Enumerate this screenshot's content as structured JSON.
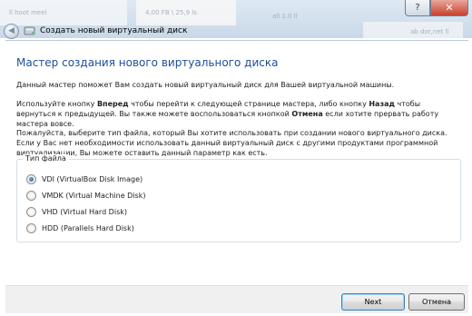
{
  "background": {
    "snippet1": "ll hoot meel",
    "snippet2": "4,00 FB \\ 25,9 ls",
    "snippet3": "all 1.0 ll",
    "snippet4": "ab dor,net ll"
  },
  "titlebar": {
    "help_glyph": "?",
    "close_glyph": "✕"
  },
  "nav": {
    "back_glyph": "◀",
    "title": "Создать новый виртуальный диск"
  },
  "wizard": {
    "heading": "Мастер создания нового виртуального диска",
    "para1": "Данный мастер поможет Вам создать новый виртуальный диск для Вашей виртуальной машины.",
    "para2_a": "Используйте кнопку ",
    "para2_b": "Вперед",
    "para2_c": " чтобы перейти к следующей странице мастера, либо кнопку ",
    "para2_d": "Назад",
    "para2_e": " чтобы вернуться к предыдущей. Вы также можете воспользоваться кнопкой ",
    "para2_f": "Отмена",
    "para2_g": " если хотите прервать работу мастера вовсе.",
    "para3": "Пожалуйста, выберите тип файла, который Вы хотите использовать при создании нового виртуального диска. Если у Вас нет необходимости использовать данный виртуальный диск с другими продуктами программной виртуализации, Вы можете оставить данный параметр как есть."
  },
  "file_type": {
    "legend": "Тип файла",
    "options": [
      {
        "label": "VDI (VirtualBox Disk Image)",
        "checked": true
      },
      {
        "label": "VMDK (Virtual Machine Disk)",
        "checked": false
      },
      {
        "label": "VHD (Virtual Hard Disk)",
        "checked": false
      },
      {
        "label": "HDD (Parallels Hard Disk)",
        "checked": false
      }
    ]
  },
  "footer": {
    "next_label": "Next",
    "cancel_label": "Отмена"
  }
}
